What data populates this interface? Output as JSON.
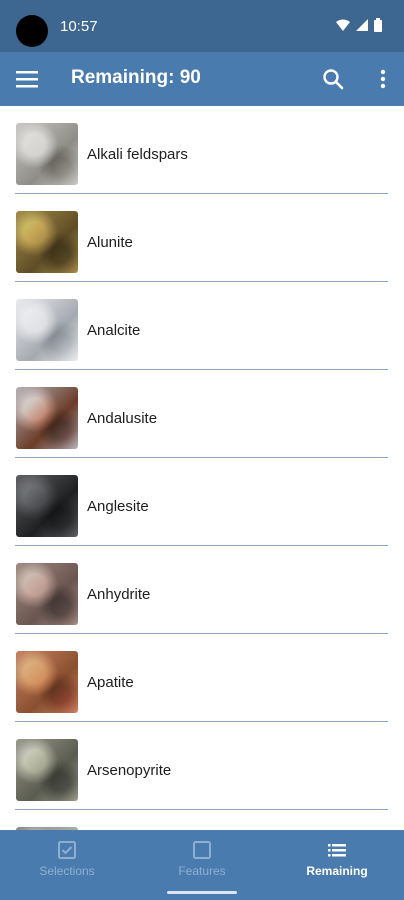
{
  "status_bar": {
    "time": "10:57"
  },
  "app_bar": {
    "title": "Remaining: 90"
  },
  "minerals": [
    {
      "name": "Alkali feldspars",
      "colors": [
        "#c9c8c4",
        "#8f8d87"
      ]
    },
    {
      "name": "Alunite",
      "colors": [
        "#a58d4b",
        "#5f4d26"
      ]
    },
    {
      "name": "Analcite",
      "colors": [
        "#e9ebee",
        "#a5a9b0"
      ]
    },
    {
      "name": "Andalusite",
      "colors": [
        "#b8b2b8",
        "#6b3c28"
      ]
    },
    {
      "name": "Anglesite",
      "colors": [
        "#5e6062",
        "#1f2022"
      ]
    },
    {
      "name": "Anhydrite",
      "colors": [
        "#a18b83",
        "#6a5650"
      ]
    },
    {
      "name": "Apatite",
      "colors": [
        "#c88261",
        "#8a5030"
      ]
    },
    {
      "name": "Arsenopyrite",
      "colors": [
        "#999a8c",
        "#5b5c50"
      ]
    },
    {
      "name": "",
      "colors": [
        "#8a8b86",
        "#b2b1aa"
      ]
    }
  ],
  "bottom_nav": {
    "items": [
      {
        "label": "Selections",
        "icon": "checkbox-checked-icon",
        "active": false
      },
      {
        "label": "Features",
        "icon": "checkbox-empty-icon",
        "active": false
      },
      {
        "label": "Remaining",
        "icon": "list-icon",
        "active": true
      }
    ]
  }
}
